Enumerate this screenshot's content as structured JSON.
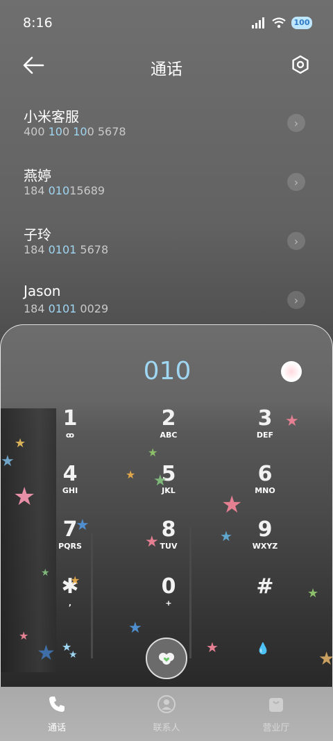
{
  "status": {
    "time": "8:16",
    "battery": "100"
  },
  "header": {
    "title": "通话"
  },
  "contacts": [
    {
      "name": "小米客服",
      "num_pre": "400 ",
      "num_hl": "10",
      "num_mid": "0 ",
      "num_hl2": "10",
      "num_post": "0 5678"
    },
    {
      "name": "燕婷",
      "num_pre": "184 ",
      "num_hl": "010",
      "num_mid": "15689",
      "num_hl2": "",
      "num_post": ""
    },
    {
      "name": "子玲",
      "num_pre": "184 ",
      "num_hl": "0101",
      "num_mid": " 5678",
      "num_hl2": "",
      "num_post": ""
    },
    {
      "name": "Jason",
      "num_pre": "184 ",
      "num_hl": "0101",
      "num_mid": " 0029",
      "num_hl2": "",
      "num_post": ""
    }
  ],
  "dialer": {
    "number": "010"
  },
  "keys": [
    {
      "digit": "1",
      "letters": "ꝏ"
    },
    {
      "digit": "2",
      "letters": "ABC"
    },
    {
      "digit": "3",
      "letters": "DEF"
    },
    {
      "digit": "4",
      "letters": "GHI"
    },
    {
      "digit": "5",
      "letters": "JKL"
    },
    {
      "digit": "6",
      "letters": "MNO"
    },
    {
      "digit": "7",
      "letters": "PQRS"
    },
    {
      "digit": "8",
      "letters": "TUV"
    },
    {
      "digit": "9",
      "letters": "WXYZ"
    },
    {
      "digit": "✱",
      "letters": ","
    },
    {
      "digit": "0",
      "letters": "+"
    },
    {
      "digit": "#",
      "letters": ""
    }
  ],
  "nav": [
    {
      "label": "通话"
    },
    {
      "label": "联系人"
    },
    {
      "label": "营业厅"
    }
  ],
  "colors": {
    "highlight": "#9fd6f2",
    "panel_border": "#ffffff"
  }
}
